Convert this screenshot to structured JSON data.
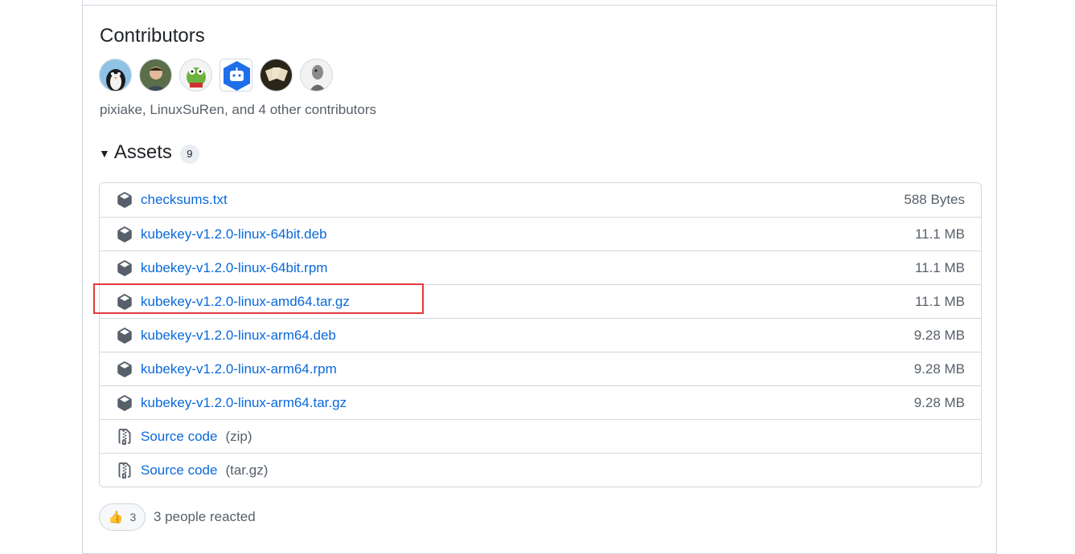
{
  "contributors": {
    "heading": "Contributors",
    "avatars": [
      "penguin-avatar",
      "person-avatar",
      "frog-avatar",
      "bot-avatar",
      "cards-avatar",
      "statue-avatar"
    ],
    "summary": "pixiake, LinuxSuRen, and 4 other contributors"
  },
  "assets": {
    "heading": "Assets",
    "count": "9",
    "items": [
      {
        "name": "checksums.txt",
        "size": "588 Bytes"
      },
      {
        "name": "kubekey-v1.2.0-linux-64bit.deb",
        "size": "11.1 MB"
      },
      {
        "name": "kubekey-v1.2.0-linux-64bit.rpm",
        "size": "11.1 MB"
      },
      {
        "name": "kubekey-v1.2.0-linux-amd64.tar.gz",
        "size": "11.1 MB"
      },
      {
        "name": "kubekey-v1.2.0-linux-arm64.deb",
        "size": "9.28 MB"
      },
      {
        "name": "kubekey-v1.2.0-linux-arm64.rpm",
        "size": "9.28 MB"
      },
      {
        "name": "kubekey-v1.2.0-linux-arm64.tar.gz",
        "size": "9.28 MB"
      }
    ],
    "source": [
      {
        "name": "Source code",
        "ext": "(zip)"
      },
      {
        "name": "Source code",
        "ext": "(tar.gz)"
      }
    ]
  },
  "reactions": {
    "emoji": "👍",
    "count": "3",
    "text": "3 people reacted"
  },
  "colors": {
    "link": "#0969da",
    "highlight": "#e5383b"
  }
}
